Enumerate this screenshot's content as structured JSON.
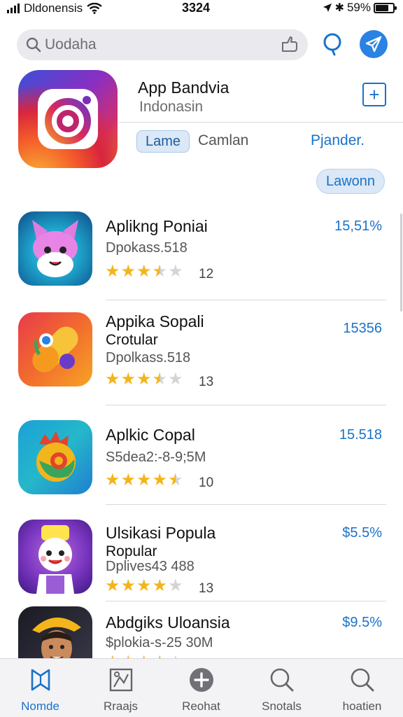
{
  "status_bar": {
    "carrier": "Dldonensis",
    "time": "3324",
    "battery": "59%"
  },
  "search": {
    "placeholder": "Uodaha"
  },
  "featured": {
    "title": "App Bandvia",
    "subtitle": "Indonasin",
    "segments": [
      "Lame",
      "Camlan",
      "Pjander."
    ],
    "button": "Lawonn"
  },
  "apps": [
    {
      "name": "Aplikng Poniai",
      "line2": "",
      "meta": "Dpokass.518",
      "rating": 3.5,
      "count": "12",
      "price": "15,51%"
    },
    {
      "name": "Appika Sopali",
      "line2": "Crotular",
      "meta": "Dpolkass.518",
      "rating": 3.5,
      "count": "13",
      "price": "15356"
    },
    {
      "name": "Aplkic Copal",
      "line2": "",
      "meta": "S5dea2:-8-9;5M",
      "rating": 4.5,
      "count": "10",
      "price": "15.518"
    },
    {
      "name": "Ulsikasi Popula",
      "line2": "Ropular",
      "meta": "Dplives43 488",
      "rating": 4,
      "count": "13",
      "price": "$5.5%"
    },
    {
      "name": "Abdgiks Uloansia",
      "line2": "",
      "meta": "$plokia-s-25 30M",
      "rating": 4,
      "count": "",
      "price": "$9.5%"
    }
  ],
  "tabs": [
    {
      "label": "Nomde",
      "icon": "map-icon",
      "active": true
    },
    {
      "label": "Rraajs",
      "icon": "puzzle-icon",
      "active": false
    },
    {
      "label": "Reohat",
      "icon": "plus-circle-icon",
      "active": false
    },
    {
      "label": "Snotals",
      "icon": "search-icon",
      "active": false
    },
    {
      "label": "hoatien",
      "icon": "search-icon",
      "active": false
    }
  ],
  "colors": {
    "accent": "#1a72c9",
    "star": "#f3b51c"
  }
}
